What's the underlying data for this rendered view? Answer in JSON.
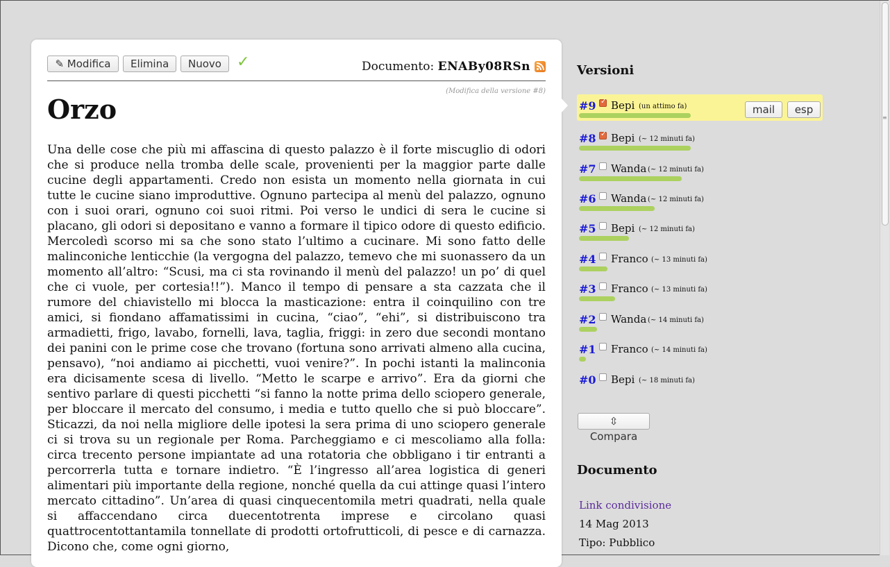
{
  "toolbar": {
    "edit_label": "✎ Modifica",
    "delete_label": "Elimina",
    "new_label": "Nuovo",
    "check_icon": "✓"
  },
  "document": {
    "label": "Documento:",
    "id": "ENABy08RSn",
    "edit_note": "(Modifica della versione #8)",
    "title": "Orzo",
    "body": "Una delle cose che più mi affascina di questo palazzo è il forte miscuglio di odori che si produce nella tromba delle scale, provenienti per la maggior parte dalle cucine degli appartamenti. Credo non esista un momento nella giornata in cui tutte le cucine siano improduttive. Ognuno partecipa al menù del palazzo, ognuno con i suoi orari, ognuno coi suoi ritmi. Poi verso le undici di sera le cucine si placano, gli odori si depositano e vanno a formare il tipico odore di questo edificio. Mercoledì scorso mi sa che sono stato l’ultimo a cucinare. Mi sono fatto delle malinconiche lenticchie (la vergogna del palazzo, temevo che mi suonassero da un momento all’altro: “Scusi, ma ci sta rovinando il menù del palazzo! un po’ di quel che ci vuole, per cortesia!!”). Manco il tempo di pensare a sta cazzata che il rumore del chiavistello mi blocca la masticazione: entra il coinquilino con tre amici, si fiondano affamatissimi in cucina, “ciao”, “ehi”, si distribuiscono tra armadietti, frigo, lavabo, fornelli, lava, taglia, friggi: in zero due secondi montano dei panini con le prime cose che trovano (fortuna sono arrivati almeno alla cucina, pensavo), “noi andiamo ai picchetti, vuoi venire?”. In pochi istanti la malinconia era dicisamente scesa di livello. “Metto le scarpe e arrivo”. Era da giorni che sentivo parlare di questi picchetti “si fanno la notte prima dello sciopero generale, per bloccare il mercato del consumo, i media e tutto quello che si può bloccare”. Sticazzi, da noi nella migliore delle ipotesi la sera prima di uno sciopero generale ci si trova su un regionale per Roma. Parcheggiamo e ci mescoliamo alla folla: circa trecento persone impiantate ad una rotatoria che obbligano i tir entranti a percorrerla tutta e tornare indietro. “È l’ingresso all’area logistica di generi alimentari più importante della regione, nonché quella da cui attinge quasi l’intero mercato cittadino”. Un’area di quasi cinquecentomila metri quadrati, nella quale si affaccendano circa duecentotrenta imprese e circolano quasi quattrocentottantamila tonnellate di prodotti ortofrutticoli, di pesce e di carnazza. Dicono che, come ogni giorno,"
  },
  "sidebar": {
    "versions_heading": "Versioni",
    "versions": [
      {
        "num": "#9",
        "checked": true,
        "user": "Bepi",
        "time": "(un attimo fa)",
        "bar": 0.74,
        "active": true
      },
      {
        "num": "#8",
        "checked": true,
        "user": "Bepi",
        "time": "(~ 12 minuti fa)",
        "bar": 0.74,
        "active": false
      },
      {
        "num": "#7",
        "checked": false,
        "user": "Wanda",
        "time": "(~ 12 minuti fa)",
        "bar": 0.68,
        "active": false
      },
      {
        "num": "#6",
        "checked": false,
        "user": "Wanda",
        "time": "(~ 12 minuti fa)",
        "bar": 0.5,
        "active": false
      },
      {
        "num": "#5",
        "checked": false,
        "user": "Bepi",
        "time": "(~ 12 minuti fa)",
        "bar": 0.33,
        "active": false
      },
      {
        "num": "#4",
        "checked": false,
        "user": "Franco",
        "time": "(~ 13 minuti fa)",
        "bar": 0.19,
        "active": false
      },
      {
        "num": "#3",
        "checked": false,
        "user": "Franco",
        "time": "(~ 13 minuti fa)",
        "bar": 0.24,
        "active": false
      },
      {
        "num": "#2",
        "checked": false,
        "user": "Wanda",
        "time": "(~ 14 minuti fa)",
        "bar": 0.12,
        "active": false
      },
      {
        "num": "#1",
        "checked": false,
        "user": "Franco",
        "time": "(~ 14 minuti fa)",
        "bar": 0.04,
        "active": false
      },
      {
        "num": "#0",
        "checked": false,
        "user": "Bepi",
        "time": "(~ 18 minuti fa)",
        "bar": 0,
        "active": false
      }
    ],
    "mail_label": "mail",
    "esp_label": "esp",
    "compare_label": "⇳ Compara",
    "doc_heading": "Documento",
    "share_link": "Link condivisione",
    "date": "14 Mag 2013",
    "type": "Tipo: Pubblico"
  },
  "colors": {
    "version_link": "#1a1ad6",
    "active_row": "#fbf496",
    "bar": "#acd15f",
    "check": "#7cc43c"
  }
}
